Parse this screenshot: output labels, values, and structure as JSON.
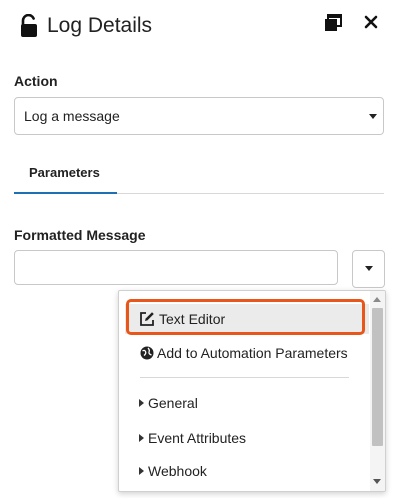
{
  "header": {
    "title": "Log Details",
    "icons": {
      "lock": "unlocked-padlock-icon",
      "popout": "window-restore-icon",
      "close": "close-icon"
    }
  },
  "action": {
    "label": "Action",
    "selected_value": "Log a message"
  },
  "tabs": [
    {
      "label": "Parameters",
      "active": true
    }
  ],
  "formatted_message": {
    "label": "Formatted Message",
    "value": "",
    "placeholder": ""
  },
  "menu": {
    "items": [
      {
        "label": "Text Editor",
        "icon": "edit-icon",
        "highlighted": true
      },
      {
        "label": "Add to Automation Parameters",
        "icon": "globe-icon"
      },
      {
        "label": "General",
        "icon": "caret-right-icon"
      },
      {
        "label": "Event Attributes",
        "icon": "caret-right-icon"
      },
      {
        "label": "Webhook",
        "icon": "caret-right-icon"
      }
    ]
  },
  "colors": {
    "accent_tab_underline": "#1f6fb5",
    "highlight_border": "#e8561a",
    "text": "#222222",
    "border": "#c8c8c8"
  }
}
